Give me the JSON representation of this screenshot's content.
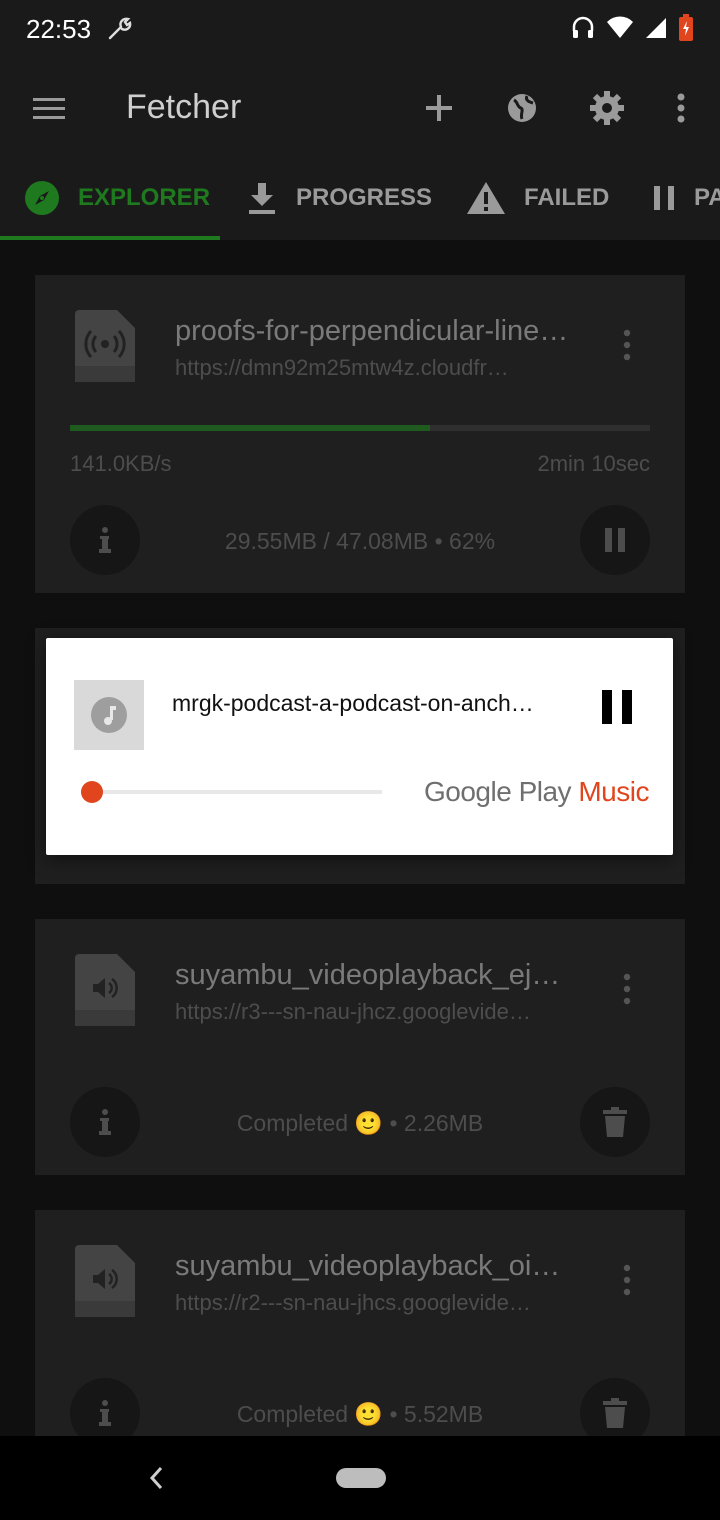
{
  "status_bar": {
    "time": "22:53"
  },
  "app_bar": {
    "title": "Fetcher"
  },
  "tabs": [
    {
      "label": "EXPLORER",
      "icon": "compass-icon",
      "active": true
    },
    {
      "label": "PROGRESS",
      "icon": "download-icon",
      "active": false
    },
    {
      "label": "FAILED",
      "icon": "warning-icon",
      "active": false
    },
    {
      "label": "PA",
      "icon": "pause-icon",
      "active": false
    }
  ],
  "downloads": [
    {
      "title": "proofs-for-perpendicular-line…",
      "url": "https://dmn92m25mtw4z.cloudfr…",
      "speed": "141.0KB/s",
      "eta": "2min 10sec",
      "progress_text": "29.55MB / 47.08MB • 62%",
      "progress": 0.62,
      "icon": "podcast-file-icon"
    },
    {
      "title": "suyambu_videoplayback_ej…",
      "url": "https://r3---sn-nau-jhcz.googlevide…",
      "status": "Completed 🙂 • 2.26MB",
      "icon": "audio-file-icon"
    },
    {
      "title": "suyambu_videoplayback_oi…",
      "url": "https://r2---sn-nau-jhcs.googlevide…",
      "status": "Completed 🙂 • 5.52MB",
      "icon": "audio-file-icon"
    }
  ],
  "player": {
    "track": "mrgk-podcast-a-podcast-on-anch…",
    "logo_google": "Google Play",
    "logo_music": "Music",
    "position": 0.0,
    "accent": "#e0451d"
  },
  "colors": {
    "accent_green": "#1f7a1f",
    "background": "#111111"
  }
}
